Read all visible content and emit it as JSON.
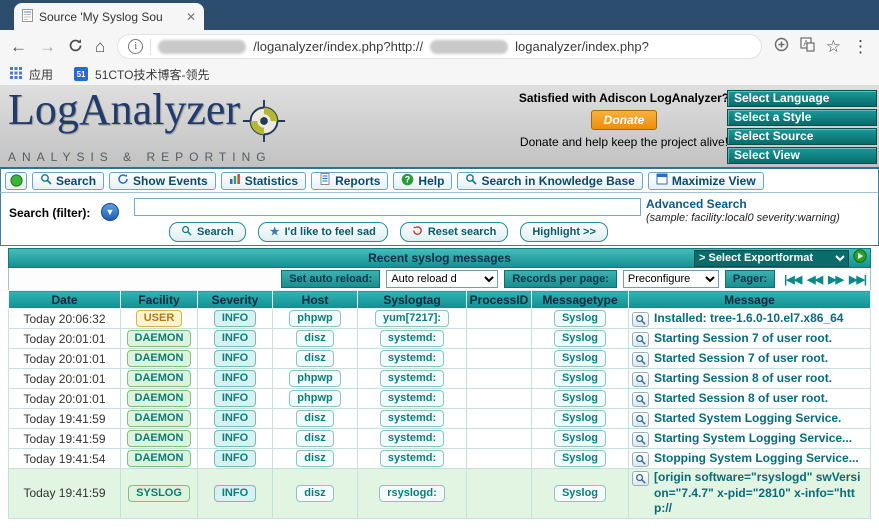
{
  "browser": {
    "tab_title": "Source 'My Syslog Sou",
    "url": {
      "part1": "/loganalyzer/index.php?http://",
      "part2": "loganalyzer/index.php?"
    },
    "bookmarks": {
      "apps_label": "应用",
      "bookmark_label": "51CTO技术博客-领先"
    }
  },
  "header": {
    "logo_title": "LogAnalyzer",
    "logo_subtitle": "ANALYSIS & REPORTING",
    "satisfied_text": "Satisfied with Adiscon LogAnalyzer?",
    "donate_button": "Donate",
    "donate_note": "Donate and help keep the project alive!",
    "select_buttons": [
      "Select Language",
      "Select a Style",
      "Select Source",
      "Select View"
    ]
  },
  "menu": {
    "items": [
      "Search",
      "Show Events",
      "Statistics",
      "Reports",
      "Help",
      "Search in Knowledge Base",
      "Maximize View"
    ]
  },
  "search": {
    "label": "Search (filter):",
    "input_value": "",
    "advanced_link": "Advanced Search",
    "sample_hint": "(sample: facility:local0 severity:warning)",
    "buttons": [
      "Search",
      "I'd like to feel sad",
      "Reset search",
      "Highlight >>"
    ]
  },
  "list": {
    "title": "Recent syslog messages",
    "export_select": "> Select Exportformat",
    "controls": {
      "auto_reload_label": "Set auto reload:",
      "auto_reload_value": "Auto reload d",
      "records_label": "Records per page:",
      "records_value": "Preconfigure",
      "pager_label": "Pager:",
      "pager_icons": [
        "first-page",
        "previous-page",
        "next-page",
        "last-page"
      ]
    }
  },
  "table": {
    "headers": [
      "Date",
      "Facility",
      "Severity",
      "Host",
      "Syslogtag",
      "ProcessID",
      "Messagetype",
      "Message"
    ],
    "rows": [
      {
        "date": "Today 20:06:32",
        "facility": "USER",
        "severity": "INFO",
        "host": "phpwp",
        "syslogtag": "yum[7217]:",
        "processid": "",
        "messagetype": "Syslog",
        "message": "Installed: tree-1.6.0-10.el7.x86_64"
      },
      {
        "date": "Today 20:01:01",
        "facility": "DAEMON",
        "severity": "INFO",
        "host": "disz",
        "syslogtag": "systemd:",
        "processid": "",
        "messagetype": "Syslog",
        "message": "Starting Session 7 of user root."
      },
      {
        "date": "Today 20:01:01",
        "facility": "DAEMON",
        "severity": "INFO",
        "host": "disz",
        "syslogtag": "systemd:",
        "processid": "",
        "messagetype": "Syslog",
        "message": "Started Session 7 of user root."
      },
      {
        "date": "Today 20:01:01",
        "facility": "DAEMON",
        "severity": "INFO",
        "host": "phpwp",
        "syslogtag": "systemd:",
        "processid": "",
        "messagetype": "Syslog",
        "message": "Starting Session 8 of user root."
      },
      {
        "date": "Today 20:01:01",
        "facility": "DAEMON",
        "severity": "INFO",
        "host": "phpwp",
        "syslogtag": "systemd:",
        "processid": "",
        "messagetype": "Syslog",
        "message": "Started Session 8 of user root."
      },
      {
        "date": "Today 19:41:59",
        "facility": "DAEMON",
        "severity": "INFO",
        "host": "disz",
        "syslogtag": "systemd:",
        "processid": "",
        "messagetype": "Syslog",
        "message": "Started System Logging Service."
      },
      {
        "date": "Today 19:41:59",
        "facility": "DAEMON",
        "severity": "INFO",
        "host": "disz",
        "syslogtag": "systemd:",
        "processid": "",
        "messagetype": "Syslog",
        "message": "Starting System Logging Service..."
      },
      {
        "date": "Today 19:41:54",
        "facility": "DAEMON",
        "severity": "INFO",
        "host": "disz",
        "syslogtag": "systemd:",
        "processid": "",
        "messagetype": "Syslog",
        "message": "Stopping System Logging Service..."
      },
      {
        "date": "Today 19:41:59",
        "facility": "SYSLOG",
        "severity": "INFO",
        "host": "disz",
        "syslogtag": "rsyslogd:",
        "processid": "",
        "messagetype": "Syslog",
        "message": "[origin software=\"rsyslogd\" swVersion=\"7.4.7\" x-pid=\"2810\" x-info=\"http://"
      }
    ]
  }
}
